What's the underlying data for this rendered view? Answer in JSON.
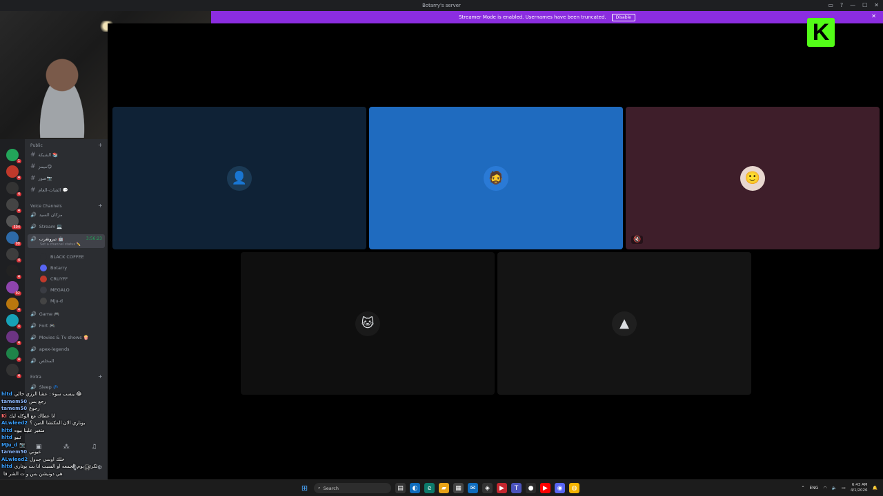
{
  "window": {
    "title": "Botarry's server"
  },
  "banner": {
    "text": "Streamer Mode is enabled. Usernames have been truncated.",
    "button": "Disable"
  },
  "overlay": {
    "kick_logo": "K"
  },
  "rail": {
    "badges": [
      "1",
      "4",
      "4",
      "4",
      "504",
      "98",
      "4",
      "4",
      "92",
      "4",
      "4",
      "4",
      "4",
      "4"
    ]
  },
  "sidebar": {
    "cat_public": "Public",
    "text_channels": [
      "الشبكة 📚",
      "ميمز😋",
      "صور📷",
      "الشات-العام 💬"
    ],
    "cat_voice": "Voice Channels",
    "voice_top": [
      "مزكان السيد",
      "Stream 💻"
    ],
    "active_voice": {
      "name": "تيرونقرب 🤖",
      "timer": "3:56:23",
      "status": "Set a channel status ✏️"
    },
    "members": [
      {
        "name": "BLACK COFFEE",
        "color": "#2b2d31"
      },
      {
        "name": "Botarry",
        "color": "#5865f2"
      },
      {
        "name": "CRUYFF",
        "color": "#c0392b"
      },
      {
        "name": "MEGALO",
        "color": "#3a3c43"
      },
      {
        "name": "Mju-d",
        "color": "#444"
      }
    ],
    "voice_rest": [
      "Game 🎮",
      "Fort 🎮",
      "Movies & Tv shows 🍿",
      "apex-legends",
      "المخلص"
    ],
    "cat_extra": "Extra",
    "extra_channels": [
      "Sleep 💤"
    ]
  },
  "chat": {
    "lines": [
      {
        "user": "hltd",
        "msg": "ينسب سوء : عشا الرزي حالي 😂"
      },
      {
        "user": "tamem50",
        "msg": "رجع بس"
      },
      {
        "user": "tamem50",
        "msg": "رجوع"
      },
      {
        "user": "Ki",
        "msg": "انا عطاك مع الوكله ليك"
      },
      {
        "user": "ALwleed2",
        "msg": "بوتاري الان المكتشا المين ؟"
      },
      {
        "user": "hltd",
        "msg": "متغير علينا بيوه"
      },
      {
        "user": "hltd",
        "msg": "تيبو"
      },
      {
        "user": "MJu_d",
        "msg": "📷"
      },
      {
        "user": "tamem50",
        "msg": "عيوني"
      },
      {
        "user": "ALwleed2",
        "msg": "خلك اوسي جدول"
      },
      {
        "user": "hltd",
        "msg": "لكرتي يوم الجمعه او السبت انا بت بوتاري"
      },
      {
        "user": "",
        "msg": "هي دونيشن بس و ت الشر فا"
      }
    ]
  },
  "stage": {
    "tiles": [
      {
        "name": "tile-1",
        "bg": "#0f2236",
        "avatar_bg": "#1b3a55",
        "glyph": "👤"
      },
      {
        "name": "tile-2",
        "bg": "#1f6bbf",
        "avatar_bg": "#2a7ad6",
        "glyph": "🧔"
      },
      {
        "name": "tile-3",
        "bg": "#3e1e2a",
        "avatar_bg": "#e8d7cf",
        "glyph": "🙂"
      },
      {
        "name": "tile-4",
        "bg": "#0f0f0f",
        "avatar_bg": "#1a1a1a",
        "glyph": "🐱"
      },
      {
        "name": "tile-5",
        "bg": "#141414",
        "avatar_bg": "#1f1f1f",
        "glyph": "▲"
      }
    ]
  },
  "taskbar": {
    "search": "Search",
    "lang": "ENG",
    "time": "6:43 AM",
    "date": "4/1/2026"
  },
  "colors": {
    "accent": "#8b2de0",
    "kick": "#53fc18",
    "speaking": "#23a55a"
  }
}
